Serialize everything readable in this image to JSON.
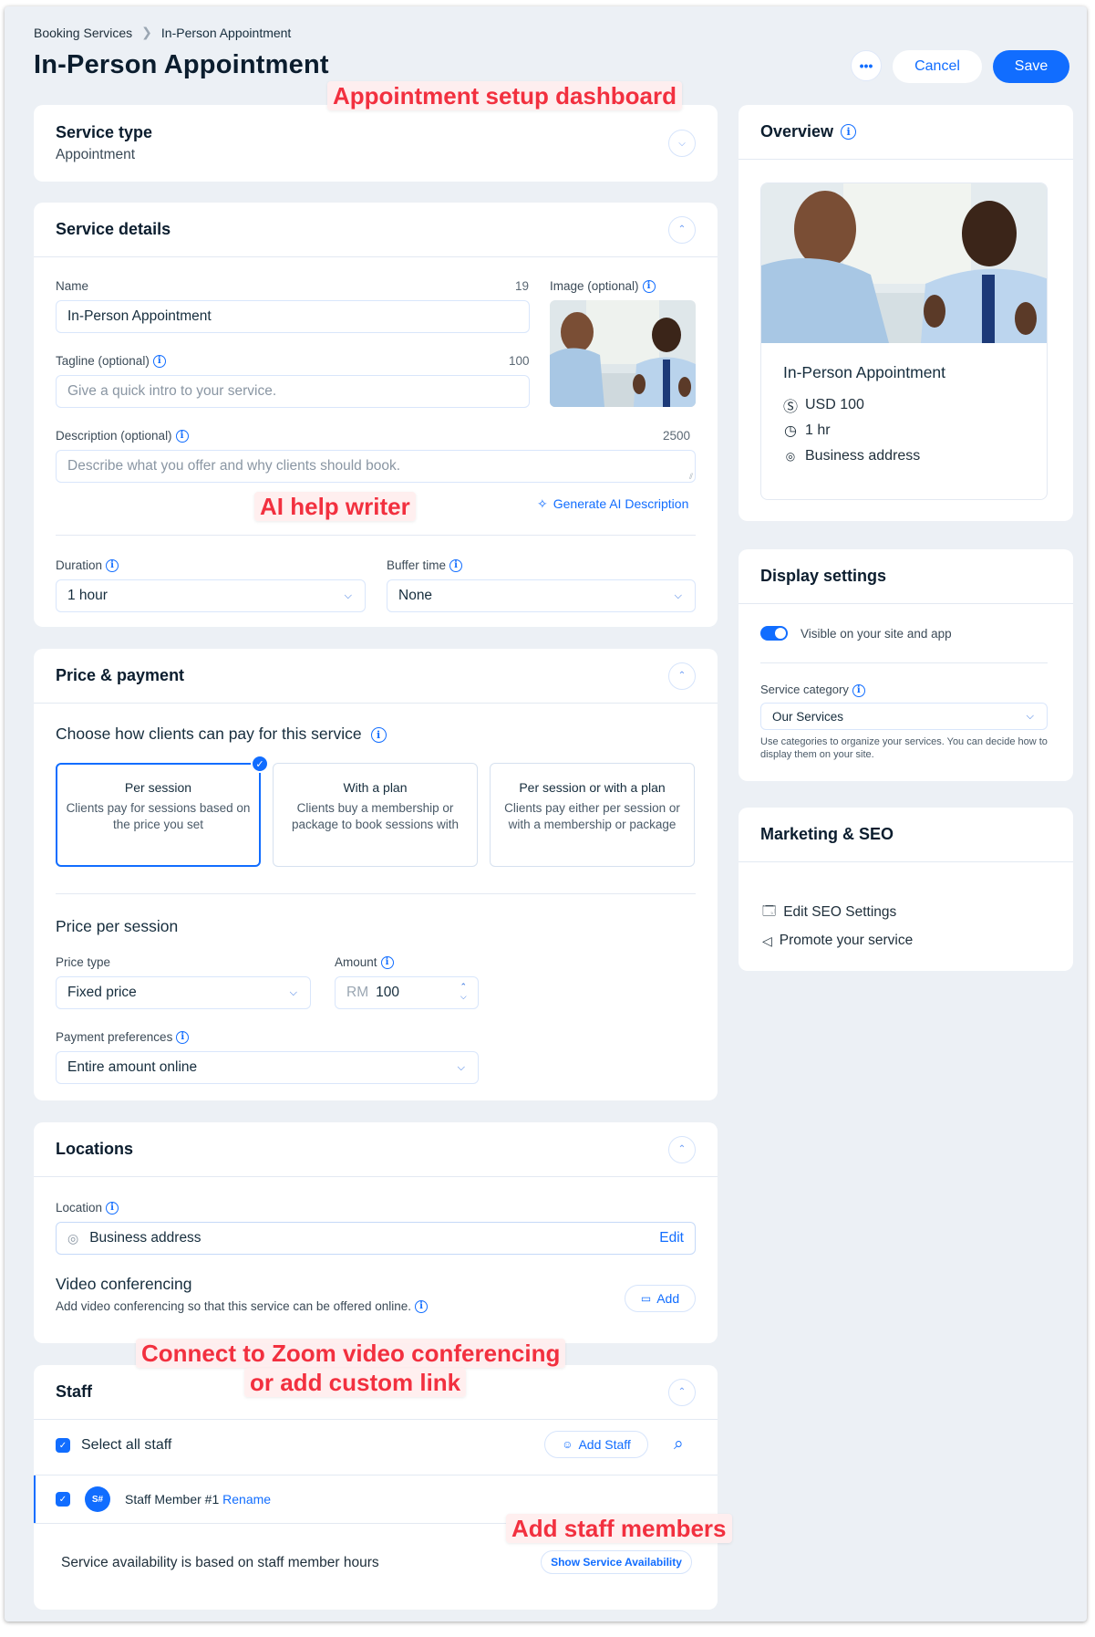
{
  "breadcrumb": {
    "root": "Booking Services",
    "current": "In-Person Appointment"
  },
  "page": {
    "title": "In-Person Appointment"
  },
  "toolbar": {
    "more_label": "•••",
    "cancel_label": "Cancel",
    "save_label": "Save"
  },
  "annotations": {
    "dashboard": "Appointment setup dashboard",
    "ai_writer": "AI help writer",
    "zoom_line1": "Connect to Zoom video conferencing",
    "zoom_line2": "or add custom link",
    "staff": "Add staff members"
  },
  "service_type": {
    "title": "Service type",
    "value": "Appointment"
  },
  "service_details": {
    "title": "Service details",
    "name": {
      "label": "Name",
      "counter": "19",
      "value": "In-Person Appointment"
    },
    "image": {
      "label": "Image (optional)"
    },
    "tagline": {
      "label": "Tagline (optional)",
      "counter": "100",
      "placeholder": "Give a quick intro to your service."
    },
    "description": {
      "label": "Description (optional)",
      "counter": "2500",
      "placeholder": "Describe what you offer and why clients should book."
    },
    "ai_link": "Generate AI Description",
    "duration": {
      "label": "Duration",
      "value": "1 hour"
    },
    "buffer": {
      "label": "Buffer time",
      "value": "None"
    }
  },
  "price_payment": {
    "title": "Price & payment",
    "question": "Choose how clients can pay for this service",
    "options": [
      {
        "title": "Per session",
        "desc": "Clients pay for sessions based on the price you set",
        "selected": true
      },
      {
        "title": "With a plan",
        "desc": "Clients buy a membership or package to book sessions with",
        "selected": false
      },
      {
        "title": "Per session or with a plan",
        "desc": "Clients pay either per session or with a membership or package",
        "selected": false
      }
    ],
    "price_per_session_title": "Price per session",
    "price_type": {
      "label": "Price type",
      "value": "Fixed price"
    },
    "amount": {
      "label": "Amount",
      "currency": "RM",
      "value": "100"
    },
    "payment_pref": {
      "label": "Payment preferences",
      "value": "Entire amount online"
    }
  },
  "locations": {
    "title": "Locations",
    "location": {
      "label": "Location",
      "value": "Business address",
      "edit_label": "Edit"
    },
    "video": {
      "title": "Video conferencing",
      "desc": "Add video conferencing so that this service can be offered online.",
      "add_label": "Add"
    }
  },
  "staff": {
    "title": "Staff",
    "select_all_label": "Select all staff",
    "add_staff_label": "Add Staff",
    "members": [
      {
        "initials": "S#",
        "name": "Staff Member #1",
        "rename_label": "Rename",
        "checked": true
      }
    ],
    "availability_text": "Service availability is based on staff member hours",
    "availability_button": "Show Service Availability"
  },
  "overview": {
    "title": "Overview",
    "service_name": "In-Person Appointment",
    "price": "USD 100",
    "duration": "1 hr",
    "location": "Business address"
  },
  "display_settings": {
    "title": "Display settings",
    "visible_label": "Visible on your site and app",
    "visible_on": true,
    "category": {
      "label": "Service category",
      "value": "Our Services",
      "help": "Use categories to organize your services. You can decide how to display them on your site."
    }
  },
  "marketing": {
    "title": "Marketing & SEO",
    "items": [
      {
        "label": "Edit SEO Settings",
        "icon": "seo-search-icon"
      },
      {
        "label": "Promote your service",
        "icon": "megaphone-icon"
      }
    ]
  },
  "colors": {
    "accent": "#116dff",
    "background": "#ecf0f5",
    "annotation": "#f2303f"
  }
}
